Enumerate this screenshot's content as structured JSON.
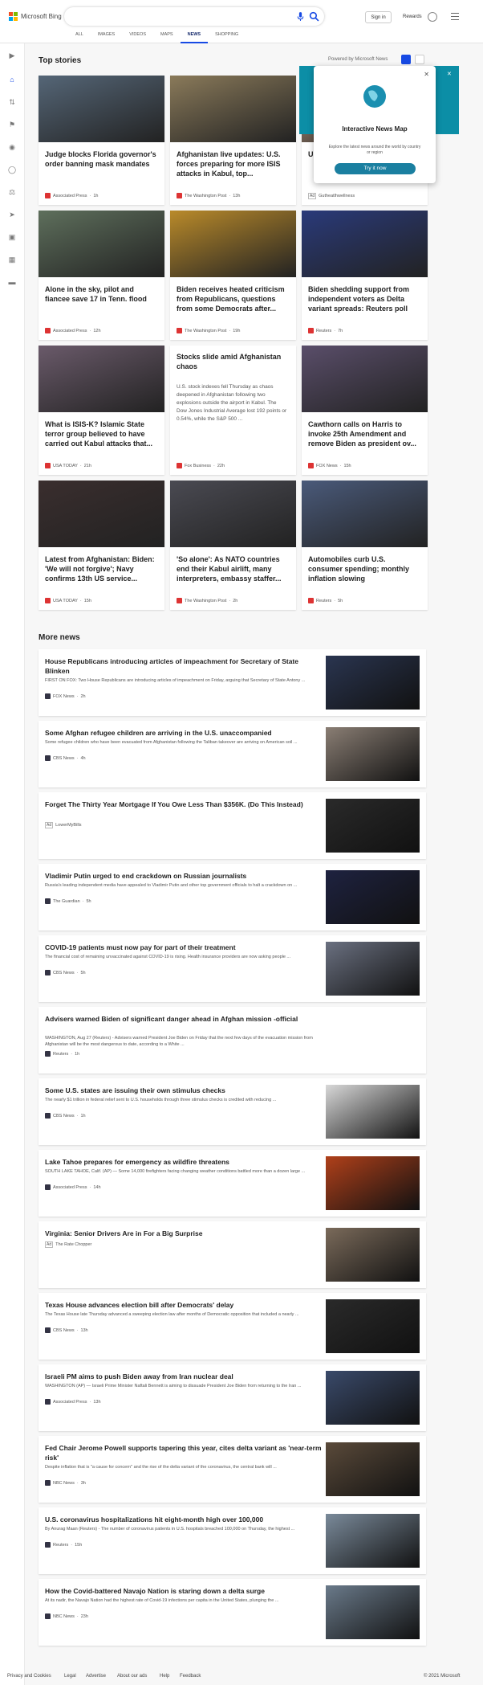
{
  "header": {
    "brand": "Microsoft Bing",
    "sign_in": "Sign in",
    "rewards": "Rewards",
    "icons": [
      "microsoft-logo",
      "microphone-icon",
      "search-icon",
      "rewards-medal-icon",
      "hamburger-menu-icon"
    ],
    "tabs": [
      {
        "label": "ALL"
      },
      {
        "label": "IMAGES"
      },
      {
        "label": "VIDEOS"
      },
      {
        "label": "MAPS"
      },
      {
        "label": "NEWS"
      },
      {
        "label": "SHOPPING"
      }
    ],
    "active_tab": "NEWS",
    "accent": "#174ae4"
  },
  "rail": {
    "icons": [
      "expand-icon",
      "home-icon",
      "shuffle-icon",
      "flag-icon",
      "location-icon",
      "globe-icon",
      "scales-icon",
      "rocket-icon",
      "film-icon",
      "briefcase-icon",
      "car-icon"
    ]
  },
  "top_stories": {
    "heading": "Top stories",
    "powered_by": "Powered by Microsoft News",
    "popup": {
      "title": "Interactive News Map",
      "desc": "Explore the latest news around the world by country or region",
      "button": "Try it now"
    },
    "cards": [
      {
        "title": "Judge blocks Florida governor's order banning mask mandates",
        "source": "Associated Press",
        "age": "1h",
        "img": "#556677"
      },
      {
        "title": "Afghanistan live updates: U.S. forces preparing for more ISIS attacks in Kabul, top...",
        "source": "The Washington Post",
        "age": "13h",
        "img": "#8a7a5a"
      },
      {
        "title": "U.S. ... Empt... Your ...",
        "source": "Gutheatlhwellness",
        "ad": "Ad",
        "age": "",
        "img": "#c9a58a"
      },
      {
        "title": "Alone in the sky, pilot and fiancee save 17 in Tenn. flood",
        "source": "Associated Press",
        "age": "12h",
        "img": "#5e6f5c"
      },
      {
        "title": "Biden receives heated criticism from Republicans, questions from some Democrats after...",
        "source": "The Washington Post",
        "age": "19h",
        "img": "#b98a2a"
      },
      {
        "title": "Biden shedding support from independent voters as Delta variant spreads: Reuters poll",
        "source": "Reuters",
        "age": "7h",
        "img": "#2a3a7a"
      },
      {
        "title": "What is ISIS-K? Islamic State terror group believed to have carried out Kabul attacks that...",
        "source": "USA TODAY",
        "age": "21h",
        "img": "#6a5a6a"
      },
      {
        "title": "Stocks slide amid Afghanistan chaos",
        "desc": "U.S. stock indexes fell Thursday as chaos deepened in Afghanistan following two explosions outside the airport in Kabul. The Dow Jones Industrial Average lost 192 points or 0.54%, while the S&P 500 ...",
        "source": "Fox Business",
        "age": "22h"
      },
      {
        "title": "Cawthorn calls on Harris to invoke 25th Amendment and remove Biden as president ov...",
        "source": "FOX News",
        "age": "15h",
        "img": "#5a4e6a"
      },
      {
        "title": "Latest from Afghanistan: Biden: 'We will not forgive'; Navy confirms 13th US service...",
        "source": "USA TODAY",
        "age": "15h",
        "img": "#3a2e2e"
      },
      {
        "title": "'So alone': As NATO countries end their Kabul airlift, many interpreters, embassy staffer...",
        "source": "The Washington Post",
        "age": "2h",
        "img": "#4a4a52"
      },
      {
        "title": "Automobiles curb U.S. consumer spending; monthly inflation slowing",
        "source": "Reuters",
        "age": "5h",
        "img": "#4a5a7a"
      }
    ]
  },
  "more_news": {
    "heading": "More news",
    "items": [
      {
        "title": "House Republicans introducing articles of impeachment for Secretary of State Blinken",
        "desc": "FIRST ON FOX: Two House Republicans are introducing articles of impeachment on Friday, arguing that Secretary of State Antony ...",
        "source": "FOX News",
        "age": "2h",
        "img": "#2a3550"
      },
      {
        "title": "Some Afghan refugee children are arriving in the U.S. unaccompanied",
        "desc": "Some refugee children who have been evacuated from Afghanistan following the Taliban takeover are arriving on American soil ...",
        "source": "CBS News",
        "age": "4h",
        "img": "#8a7e74"
      },
      {
        "title": "Forget The Thirty Year Mortgage If You Owe Less Than $356K. (Do This Instead)",
        "desc": "",
        "source": "LowerMyBills",
        "ad": "Ad",
        "age": "",
        "img": "#2a2a2a"
      },
      {
        "title": "Vladimir Putin urged to end crackdown on Russian journalists",
        "desc": "Russia's leading independent media have appealed to Vladimir Putin and other top government officials to halt a crackdown on ...",
        "source": "The Guardian",
        "age": "5h",
        "img": "#1e2240"
      },
      {
        "title": "COVID-19 patients must now pay for part of their treatment",
        "desc": "The financial cost of remaining unvaccinated against COVID-19 is rising. Health insurance providers are now asking people ...",
        "source": "CBS News",
        "age": "5h",
        "img": "#6a7080"
      },
      {
        "title": "Advisers warned Biden of significant danger ahead in Afghan mission -official",
        "desc": "WASHINGTON, Aug 27 (Reuters) - Advisers warned President Joe Biden on Friday that the next few days of the evacuation mission from Afghanistan will be the most dangerous to date, according to a White ...",
        "source": "Reuters",
        "age": "1h",
        "img": ""
      },
      {
        "title": "Some U.S. states are issuing their own stimulus checks",
        "desc": "The nearly $1 trillion in federal relief sent to U.S. households through three stimulus checks is credited with reducing ...",
        "source": "CBS News",
        "age": "1h",
        "img": "#d8d8d8"
      },
      {
        "title": "Lake Tahoe prepares for emergency as wildfire threatens",
        "desc": "SOUTH LAKE TAHOE, Calif. (AP) — Some 14,000 firefighters facing changing weather conditions battled more than a dozen large ...",
        "source": "Associated Press",
        "age": "14h",
        "img": "#b0401a"
      },
      {
        "title": "Virginia: Senior Drivers Are in For a Big Surprise",
        "desc": "",
        "source": "The Rate Chopper",
        "ad": "Ad",
        "age": "",
        "img": "#7a6a5a"
      },
      {
        "title": "Texas House advances election bill after Democrats' delay",
        "desc": "The Texas House late Thursday advanced a sweeping election law after months of Democratic opposition that included a nearly ...",
        "source": "CBS News",
        "age": "13h",
        "img": "#2a2a2a"
      },
      {
        "title": "Israeli PM aims to push Biden away from Iran nuclear deal",
        "desc": "WASHINGTON (AP) — Israeli Prime Minister Naftali Bennett is aiming to dissuade President Joe Biden from returning to the Iran ...",
        "source": "Associated Press",
        "age": "13h",
        "img": "#3a4a6a"
      },
      {
        "title": "Fed Chair Jerome Powell supports tapering this year, cites delta variant as 'near-term risk'",
        "desc": "Despite inflation that is \"a cause for concern\" and the rise of the delta variant of the coronavirus, the central bank will ...",
        "source": "NBC News",
        "age": "3h",
        "img": "#5a4a3a"
      },
      {
        "title": "U.S. coronavirus hospitalizations hit eight-month high over 100,000",
        "desc": "By Anurag Maan (Reuters) - The number of coronavirus patients in U.S. hospitals breached 100,000 on Thursday, the highest ...",
        "source": "Reuters",
        "age": "15h",
        "img": "#7a8a9a"
      },
      {
        "title": "How the Covid-battered Navajo Nation is staring down a delta surge",
        "desc": "At its nadir, the Navajo Nation had the highest rate of Covid-19 infections per capita in the United States, plunging the ...",
        "source": "NBC News",
        "age": "23h",
        "img": "#6a7a8a"
      }
    ]
  },
  "footer": {
    "links": [
      "Privacy and Cookies",
      "Legal",
      "Advertise",
      "About our ads",
      "Help",
      "Feedback"
    ],
    "copyright": "© 2021 Microsoft"
  }
}
